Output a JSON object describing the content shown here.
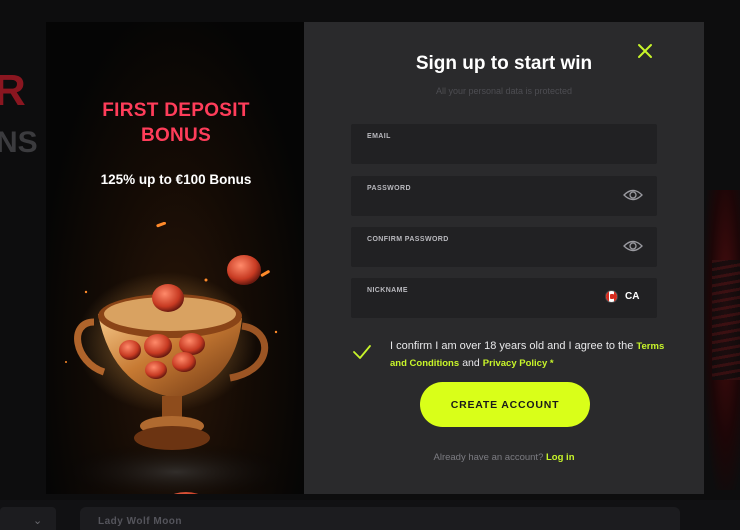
{
  "background": {
    "left_letters": "R",
    "left_letters2": "NS",
    "bottom_item": "Lady Wolf Moon"
  },
  "promo": {
    "title": "FIRST DEPOSIT BONUS",
    "subtitle": "125% up to €100 Bonus"
  },
  "modal": {
    "title": "Sign up to start win",
    "subtitle": "All your personal data is protected",
    "close_icon": "close-icon",
    "fields": {
      "email": {
        "label": "EMAIL",
        "value": ""
      },
      "password": {
        "label": "PASSWORD",
        "value": ""
      },
      "confirm_password": {
        "label": "CONFIRM PASSWORD",
        "value": ""
      },
      "nickname": {
        "label": "NICKNAME",
        "value": ""
      }
    },
    "country": {
      "code": "CA",
      "flag": "canada-flag"
    },
    "agreement": {
      "checked": true,
      "text": "I confirm I am over 18 years old and I agree to the",
      "terms_link": "Terms and Conditions",
      "and": "and",
      "privacy_link": "Privacy Policy *"
    },
    "cta_label": "CREATE ACCOUNT",
    "login_prompt": "Already have an account?",
    "login_link": "Log in"
  },
  "colors": {
    "accent": "#d9ff19",
    "link": "#c8f52a",
    "promo_title": "#ff3d5a",
    "modal_bg": "#2a2a2c",
    "field_bg": "#212123"
  }
}
